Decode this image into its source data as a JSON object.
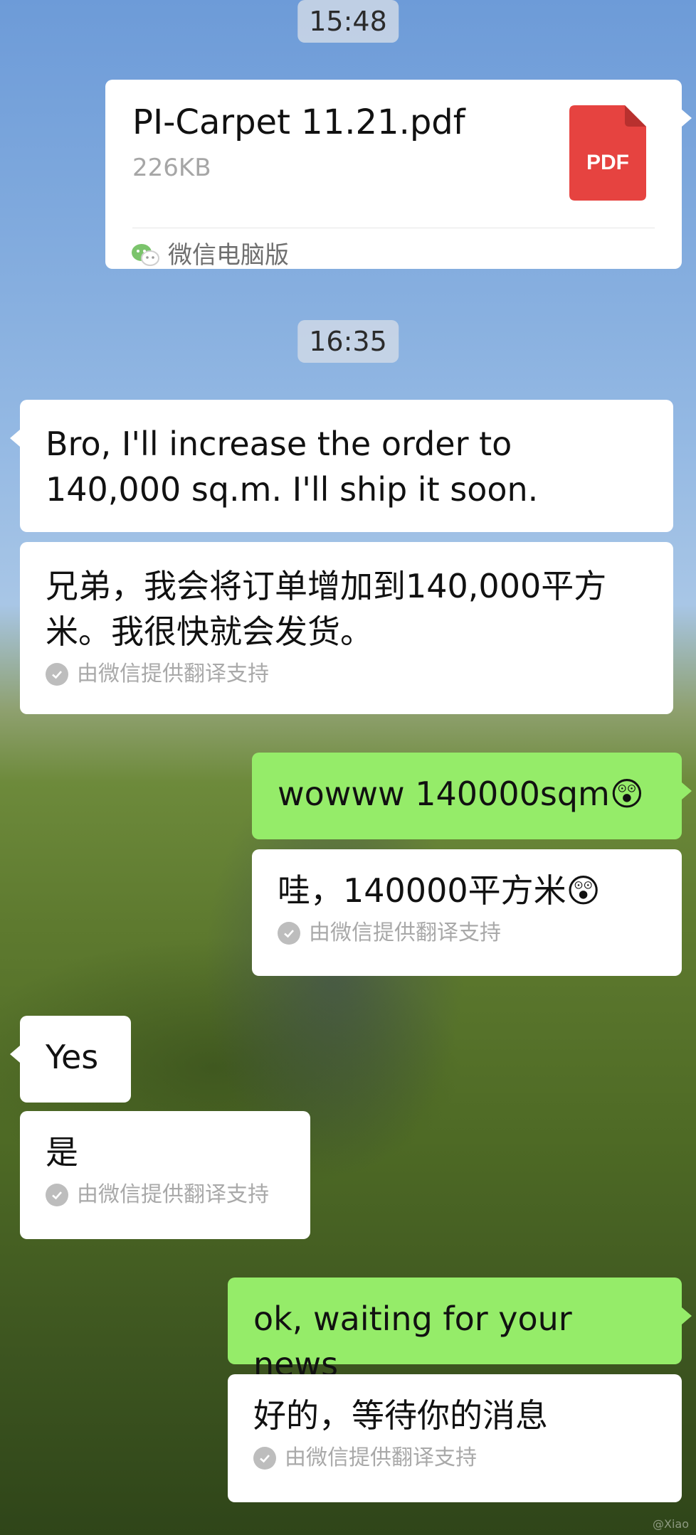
{
  "timestamps": [
    "15:48",
    "16:35"
  ],
  "file_message": {
    "file_name": "PI-Carpet 11.21.pdf",
    "file_size": "226KB",
    "file_type_label": "PDF",
    "source": "微信电脑版",
    "icon_color": "#e64340"
  },
  "messages": [
    {
      "side": "left",
      "text": "Bro, I'll increase the order to 140,000 sq.m. I'll ship it soon.",
      "translation": "兄弟，我会将订单增加到140,000平方米。我很快就会发货。"
    },
    {
      "side": "right",
      "text": "wowww 140000sqm😲",
      "translation": "哇，140000平方米😲"
    },
    {
      "side": "left",
      "text": "Yes",
      "translation": "是"
    },
    {
      "side": "right",
      "text": "ok, waiting for your news",
      "translation": "好的，等待你的消息"
    }
  ],
  "translation_credit": "由微信提供翻译支持",
  "watermark": "@Xiao",
  "colors": {
    "sent_bubble": "#95ec69",
    "received_bubble": "#ffffff",
    "pdf_red": "#e64340",
    "timestamp_bg": "#ced8e6"
  }
}
